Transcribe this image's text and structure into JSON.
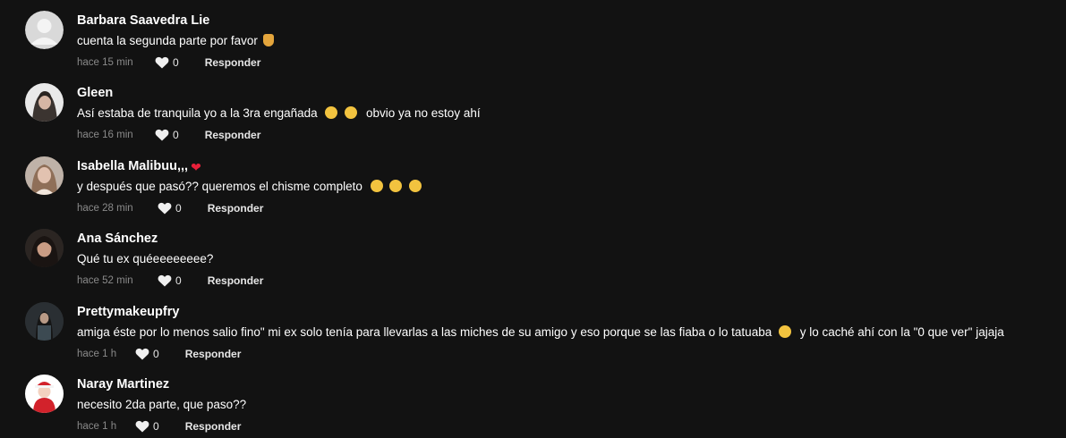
{
  "comments": [
    {
      "username": "Barbara Saavedra Lie",
      "text": "cuenta la segunda parte por favor",
      "emoji_after": "folded-hands",
      "time": "hace 15 min",
      "likes": "0",
      "reply_label": "Responder"
    },
    {
      "username": "Gleen",
      "text_before": "Así estaba de tranquila yo a la 3ra engañada",
      "text_after": "obvio ya no estoy ahí",
      "emoji_between": [
        "sweat-smile-face",
        "joy-face"
      ],
      "time": "hace 16 min",
      "likes": "0",
      "reply_label": "Responder"
    },
    {
      "username": "Isabella Malibuu,,,",
      "username_icon": "red-heart",
      "text": "y después que pasó?? queremos el chisme completo",
      "emoji_after": [
        "flushed-face",
        "flushed-face",
        "flushed-face"
      ],
      "time": "hace 28 min",
      "likes": "0",
      "reply_label": "Responder"
    },
    {
      "username": "Ana Sánchez",
      "text": "Qué tu ex quéeeeeeeee?",
      "time": "hace 52 min",
      "likes": "0",
      "reply_label": "Responder"
    },
    {
      "username": "Prettymakeupfry",
      "text_before": "amiga éste por lo menos salio fino\" mi ex solo tenía para llevarlas a las miches de su amigo y eso porque se las fiaba o lo tatuaba",
      "text_after": "y lo caché ahí con la \"0 que ver\" jajaja",
      "emoji_between": [
        "rofl-face"
      ],
      "time": "hace 1 h",
      "likes": "0",
      "reply_label": "Responder"
    },
    {
      "username": "Naray Martinez",
      "text": "necesito 2da parte, que paso??",
      "time": "hace 1 h",
      "likes": "0",
      "reply_label": "Responder"
    }
  ],
  "colors": {
    "background": "#121212",
    "username": "#ffffff",
    "time": "#8a8a8a",
    "heart": "#e8203a"
  }
}
